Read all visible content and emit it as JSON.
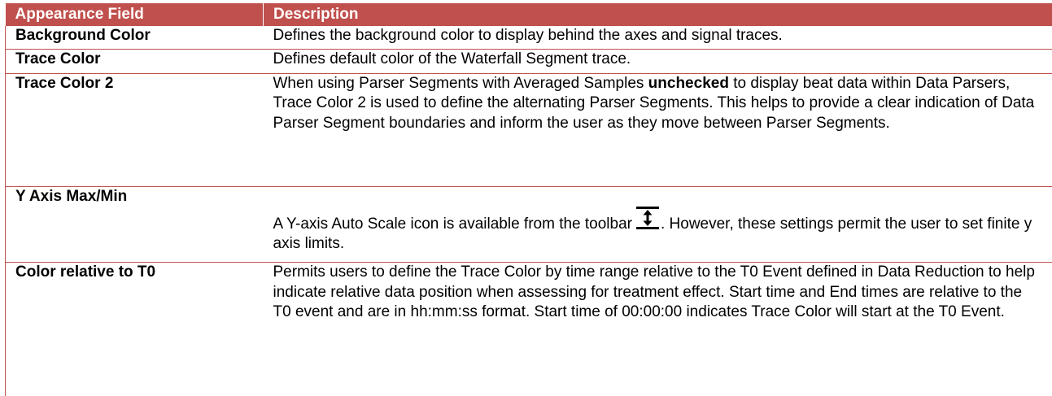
{
  "table": {
    "headers": [
      "Appearance Field",
      "Description"
    ],
    "accent_color": "#c0504d",
    "rows": [
      {
        "field": "Background Color",
        "description": "Defines the background color to display behind the axes and signal traces."
      },
      {
        "field": "Trace Color",
        "description": "Defines default color of the Waterfall Segment trace."
      },
      {
        "field": "Trace Color 2",
        "description_parts": [
          "When using Parser Segments with Averaged Samples ",
          "unchecked",
          " to display beat data within Data Parsers, Trace Color 2 is used to define the alternating Parser Segments. This helps to provide a clear indication of Data Parser Segment boundaries and inform the user as they move between Parser Segments."
        ]
      },
      {
        "field": "Y Axis Max/Min",
        "description_parts": [
          "A Y-axis Auto Scale icon is available from the toolbar",
          ". However, these settings permit the user to set finite y axis limits."
        ],
        "icon": "y-axis-auto-scale-icon"
      },
      {
        "field": "Color relative to T0",
        "description": "Permits users to define the Trace Color by time range relative to the T0 Event defined in Data Reduction to help indicate relative data position when assessing for treatment effect. Start time and End times are relative to the T0 event and are in hh:mm:ss format. Start time of 00:00:00 indicates Trace Color will start at the T0 Event."
      }
    ]
  }
}
